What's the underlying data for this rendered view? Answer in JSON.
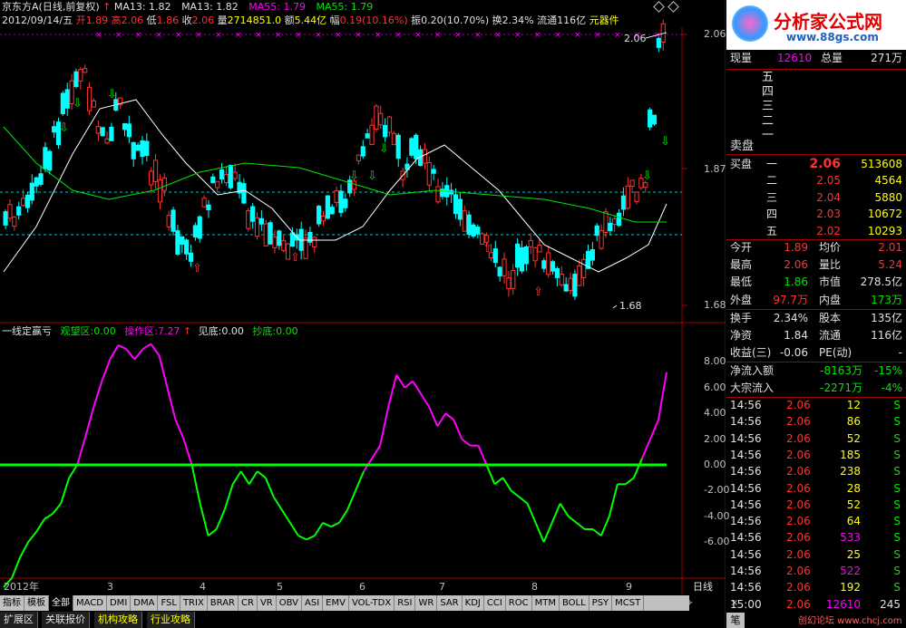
{
  "header": {
    "stock": "京东方A",
    "period": "(日线,前复权)",
    "ma13_a": "MA13: 1.82",
    "ma13_b": "MA13: 1.82",
    "ma55_a": "MA55: 1.79",
    "ma55_b": "MA55: 1.79"
  },
  "info": {
    "date": "2012/09/14/五",
    "open_l": "开",
    "open_v": "1.89",
    "high_l": "高",
    "high_v": "2.06",
    "low_l": "低",
    "low_v": "1.86",
    "close_l": "收",
    "close_v": "2.06",
    "vol_l": "量",
    "vol_v": "2714851.0",
    "amt_l": "额",
    "amt_v": "5.44亿",
    "chg_l": "幅",
    "chg_v": "0.19(10.16%)",
    "amp_l": "振",
    "amp_v": "0.20(10.70%)",
    "turn_l": "换",
    "turn_v": "2.34%",
    "float_l": "流通",
    "float_v": "116亿",
    "sector": "元器件"
  },
  "main_chart": {
    "y_labels": [
      "2.06",
      "1.87",
      "1.68"
    ],
    "hi_marker": "2.06",
    "lo_marker": "1.68"
  },
  "indicator": {
    "name": "一线定赢亏",
    "z1_l": "观望区:",
    "z1_v": "0.00",
    "z2_l": "操作区:",
    "z2_v": "7.27",
    "z3_l": "见底:",
    "z3_v": "0.00",
    "z4_l": "抄底:",
    "z4_v": "0.00",
    "y_labels": [
      "8.00",
      "6.00",
      "4.00",
      "2.00",
      "0.00",
      "-2.00",
      "-4.00",
      "-6.00"
    ]
  },
  "x_axis": [
    "2012年",
    "3",
    "4",
    "5",
    "6",
    "7",
    "8",
    "9"
  ],
  "period_label": "日线",
  "tabs": [
    "指标",
    "模板",
    "全部",
    "MACD",
    "DMI",
    "DMA",
    "FSL",
    "TRIX",
    "BRAR",
    "CR",
    "VR",
    "OBV",
    "ASI",
    "EMV",
    "VOL-TDX",
    "RSI",
    "WR",
    "SAR",
    "KDJ",
    "CCI",
    "ROC",
    "MTM",
    "BOLL",
    "PSY",
    "MCST"
  ],
  "tabs2": [
    "扩展区",
    "关联报价",
    "机构攻略",
    "行业攻略"
  ],
  "logo": {
    "title": "分析家公式网",
    "url": "www.88gs.com"
  },
  "quote": {
    "xianliang_l": "现量",
    "xianliang_v": "12610",
    "zongliang_l": "总量",
    "zongliang_v": "271万",
    "sell_label": "卖盘",
    "sell_levels": [
      "五",
      "四",
      "三",
      "二",
      "一"
    ],
    "buy_label": "买盘",
    "buy": [
      {
        "lvl": "一",
        "price": "2.06",
        "vol": "513608"
      },
      {
        "lvl": "二",
        "price": "2.05",
        "vol": "4564"
      },
      {
        "lvl": "三",
        "price": "2.04",
        "vol": "5880"
      },
      {
        "lvl": "四",
        "price": "2.03",
        "vol": "10672"
      },
      {
        "lvl": "五",
        "price": "2.02",
        "vol": "10293"
      }
    ],
    "stats": [
      {
        "l1": "今开",
        "v1": "1.89",
        "l2": "均价",
        "v2": "2.01"
      },
      {
        "l1": "最高",
        "v1": "2.06",
        "l2": "量比",
        "v2": "5.24"
      },
      {
        "l1": "最低",
        "v1": "1.86",
        "l2": "市值",
        "v2": "278.5亿"
      },
      {
        "l1": "外盘",
        "v1": "97.7万",
        "l2": "内盘",
        "v2": "173万"
      }
    ],
    "stats2": [
      {
        "l1": "换手",
        "v1": "2.34%",
        "l2": "股本",
        "v2": "135亿"
      },
      {
        "l1": "净资",
        "v1": "1.84",
        "l2": "流通",
        "v2": "116亿"
      },
      {
        "l1": "收益(三)",
        "v1": "-0.06",
        "l2": "PE(动)",
        "v2": "-"
      }
    ],
    "flow": [
      {
        "l": "净流入额",
        "v": "-8163万",
        "p": "-15%"
      },
      {
        "l": "大宗流入",
        "v": "-2271万",
        "p": "-4%"
      }
    ],
    "ticks": [
      {
        "t": "14:56",
        "p": "2.06",
        "v": "12",
        "s": "S"
      },
      {
        "t": "14:56",
        "p": "2.06",
        "v": "86",
        "s": "S"
      },
      {
        "t": "14:56",
        "p": "2.06",
        "v": "52",
        "s": "S"
      },
      {
        "t": "14:56",
        "p": "2.06",
        "v": "185",
        "s": "S"
      },
      {
        "t": "14:56",
        "p": "2.06",
        "v": "238",
        "s": "S"
      },
      {
        "t": "14:56",
        "p": "2.06",
        "v": "28",
        "s": "S"
      },
      {
        "t": "14:56",
        "p": "2.06",
        "v": "52",
        "s": "S"
      },
      {
        "t": "14:56",
        "p": "2.06",
        "v": "64",
        "s": "S"
      },
      {
        "t": "14:56",
        "p": "2.06",
        "v": "533",
        "s": "S"
      },
      {
        "t": "14:56",
        "p": "2.06",
        "v": "25",
        "s": "S"
      },
      {
        "t": "14:56",
        "p": "2.06",
        "v": "522",
        "s": "S"
      },
      {
        "t": "14:56",
        "p": "2.06",
        "v": "192",
        "s": "S"
      },
      {
        "t": "15:00",
        "p": "2.06",
        "v": "12610",
        "s": "245"
      }
    ],
    "bottom_tab": "笔",
    "watermark": "创幻论坛 www.chcj.com"
  },
  "colors": {
    "up": "#ff3232",
    "down": "#00ffff",
    "ma13": "#ffffff",
    "ma55": "#00e600",
    "osc_pos": "#ff00ff",
    "osc_neg": "#00ff00"
  },
  "chart_data": {
    "type": "line",
    "title": "一线定赢亏",
    "series": [
      {
        "name": "一线定赢亏",
        "values": [
          -9.5,
          -8.8,
          -7.2,
          -6.0,
          -5.2,
          -4.2,
          -3.8,
          -3.0,
          -1.0,
          0.0,
          2.2,
          4.5,
          6.5,
          8.2,
          9.3,
          9.0,
          8.2,
          9.0,
          9.4,
          8.5,
          6.0,
          3.5,
          2.0,
          0.0,
          -3.0,
          -5.5,
          -5.0,
          -3.5,
          -1.5,
          -0.5,
          -1.5,
          -0.5,
          -1.0,
          -2.5,
          -3.5,
          -4.5,
          -5.5,
          -5.8,
          -5.5,
          -4.5,
          -4.8,
          -4.5,
          -3.5,
          -2.0,
          -0.5,
          0.5,
          1.5,
          4.5,
          7.0,
          6.0,
          6.5,
          5.5,
          4.5,
          3.0,
          4.0,
          3.5,
          2.0,
          1.5,
          1.5,
          0.0,
          -1.5,
          -1.0,
          -2.0,
          -2.5,
          -3.0,
          -4.5,
          -6.0,
          -4.5,
          -3.0,
          -4.0,
          -4.5,
          -5.0,
          -5.0,
          -5.5,
          -4.0,
          -1.5,
          -1.5,
          -1.0,
          0.5,
          2.0,
          3.5,
          7.2
        ]
      }
    ],
    "ylim": [
      -9.6,
      10.5
    ]
  }
}
